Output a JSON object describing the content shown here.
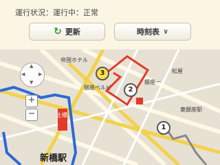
{
  "status": {
    "text": "運行状況：運行中：正常"
  },
  "toolbar": {
    "refresh_label": "更新",
    "timetable_label": "時刻表"
  },
  "icons": {
    "refresh": "refresh-icon",
    "chevron": "chevron-down-icon",
    "zoom_in": "plus-icon",
    "zoom_out": "minus-icon"
  },
  "map": {
    "labels": {
      "teikoku": "帝国ホテル",
      "ginza_bell": "銀座ベルビ",
      "matsuya": "松屋",
      "ginza_itchome": "銀座一",
      "higashi_ginza": "東銀座駅",
      "shinbashi": "新橋駅",
      "tochi": "土橋"
    },
    "pins": [
      "1",
      "2",
      "3"
    ],
    "zoom": {
      "in": "+",
      "out": "−"
    },
    "pad": {
      "n": "▲",
      "s": "▼",
      "w": "◀",
      "e": "▶"
    }
  },
  "colors": {
    "route": "#e23b2a",
    "bus_line": "#2b6ad8",
    "accent": "#2d9a2d"
  }
}
